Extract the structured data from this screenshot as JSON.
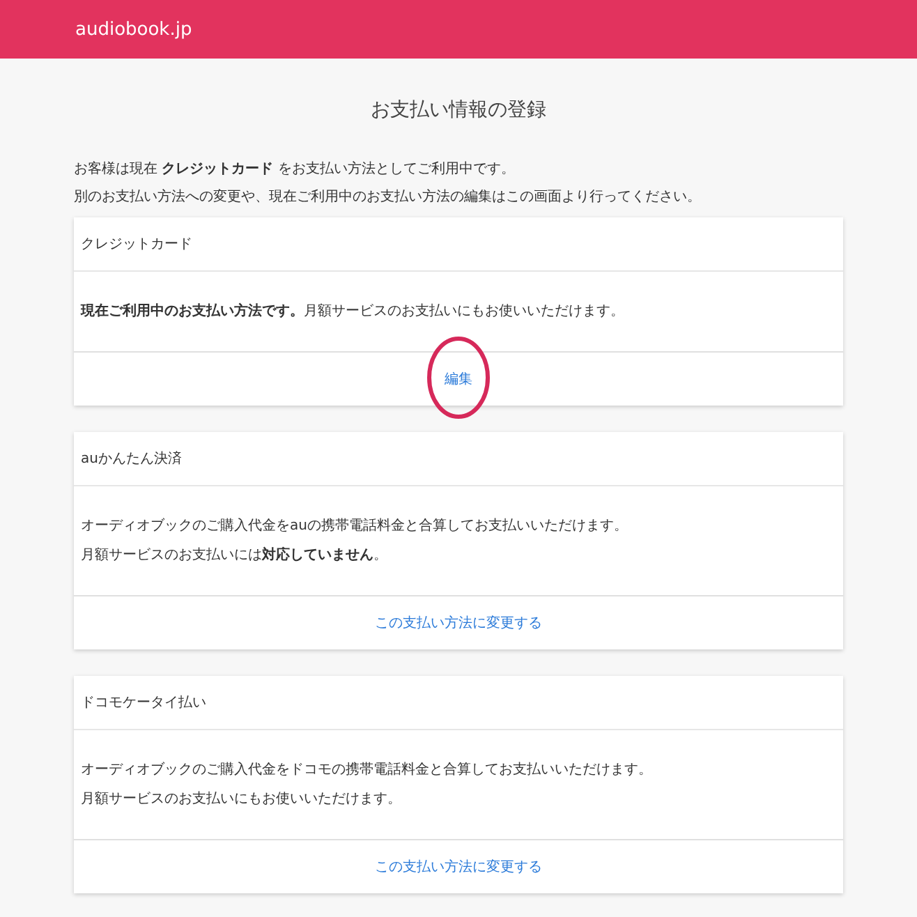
{
  "header": {
    "logo": "audiobook.jp"
  },
  "page_title": "お支払い情報の登録",
  "intro": [
    "お客様は現在 **クレジットカード** をお支払い方法としてご利用中です。",
    "別のお支払い方法への変更や、現在ご利用中のお支払い方法の編集はこの画面より行ってください。"
  ],
  "methods": [
    {
      "title": "クレジットカード",
      "lines": [
        "**現在ご利用中のお支払い方法です。**月額サービスのお支払いにもお使いいただけます。"
      ],
      "action": "編集",
      "highlighted": true
    },
    {
      "title": "auかんたん決済",
      "lines": [
        "オーディオブックのご購入代金をauの携帯電話料金と合算してお支払いいただけます。",
        "月額サービスのお支払いには**対応していません**。"
      ],
      "action": "この支払い方法に変更する",
      "highlighted": false
    },
    {
      "title": "ドコモケータイ払い",
      "lines": [
        "オーディオブックのご購入代金をドコモの携帯電話料金と合算してお支払いいただけます。",
        "月額サービスのお支払いにもお使いいただけます。"
      ],
      "action": "この支払い方法に変更する",
      "highlighted": false
    }
  ]
}
